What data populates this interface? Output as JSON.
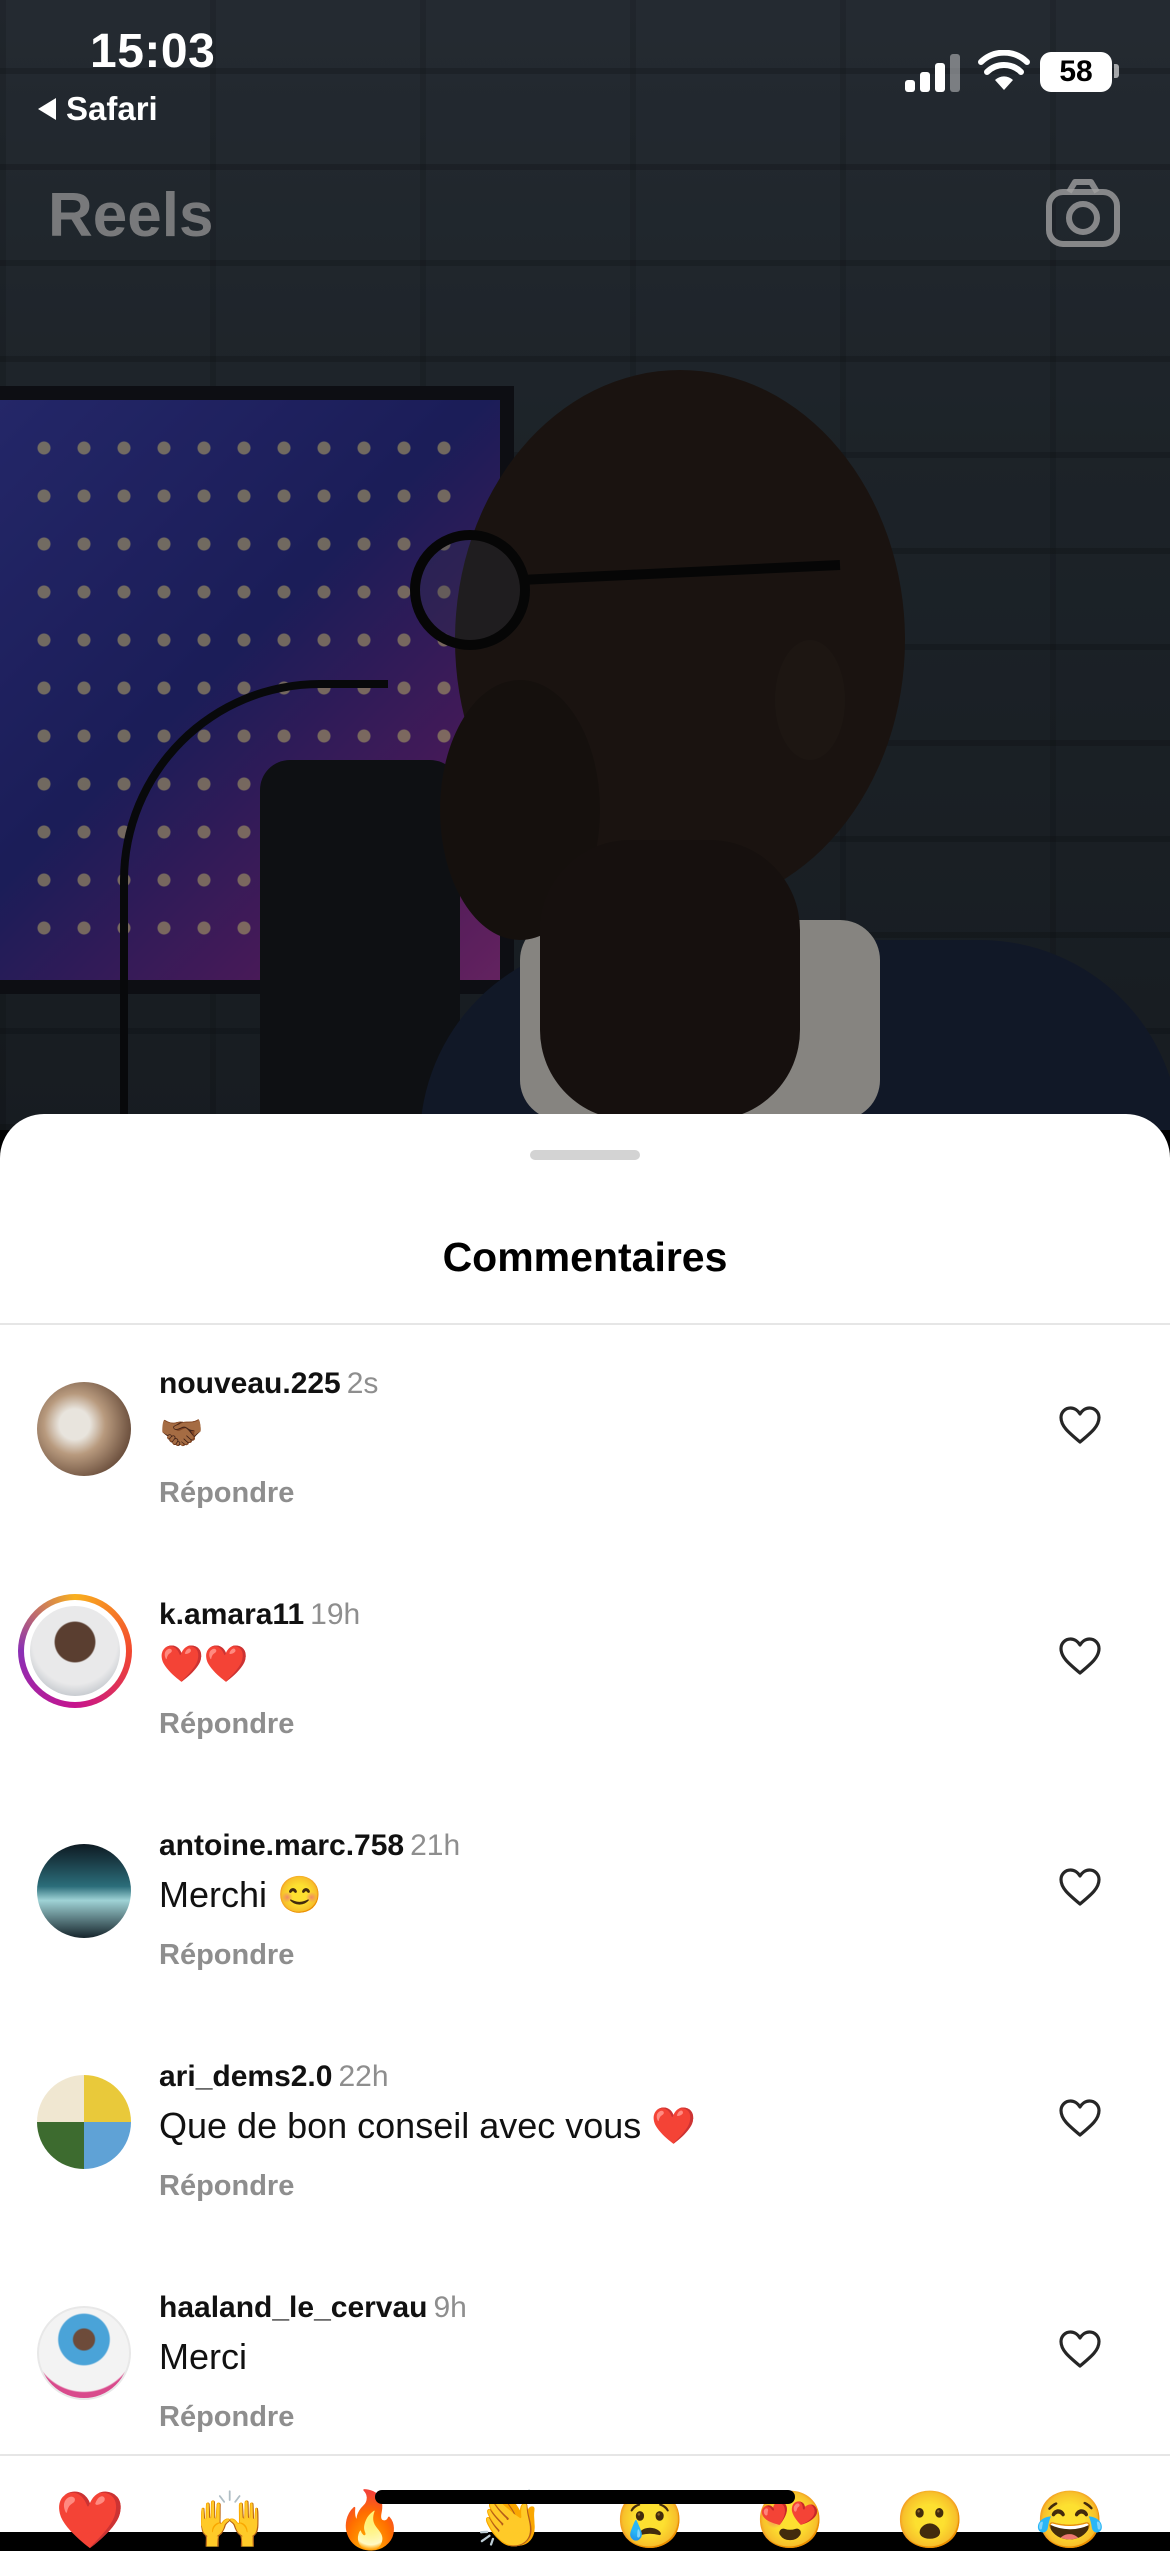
{
  "status_bar": {
    "time": "15:03",
    "back_app": "Safari",
    "battery": "58"
  },
  "reels_header": {
    "title": "Reels",
    "camera_icon": "camera-icon"
  },
  "sheet": {
    "title": "Commentaires"
  },
  "comments": [
    {
      "username": "nouveau.225",
      "time": "2s",
      "text": "🤝🏾",
      "reply": "Répondre"
    },
    {
      "username": "k.amara11",
      "time": "19h",
      "text": "❤️❤️",
      "reply": "Répondre"
    },
    {
      "username": "antoine.marc.758",
      "time": "21h",
      "text": "Merchi 😊",
      "reply": "Répondre"
    },
    {
      "username": "ari_dems2.0",
      "time": "22h",
      "text": "Que de bon conseil avec vous ❤️",
      "reply": "Répondre"
    },
    {
      "username": "haaland_le_cervau",
      "time": "9h",
      "text": "Merci",
      "reply": "Répondre"
    }
  ],
  "emoji_bar": [
    "❤️",
    "🙌",
    "🔥",
    "👏",
    "😢",
    "😍",
    "😮",
    "😂"
  ],
  "colors": {
    "secondary_text": "#8e8e8e",
    "sheet_bg": "#ffffff",
    "story_ring": "#c6148e"
  }
}
